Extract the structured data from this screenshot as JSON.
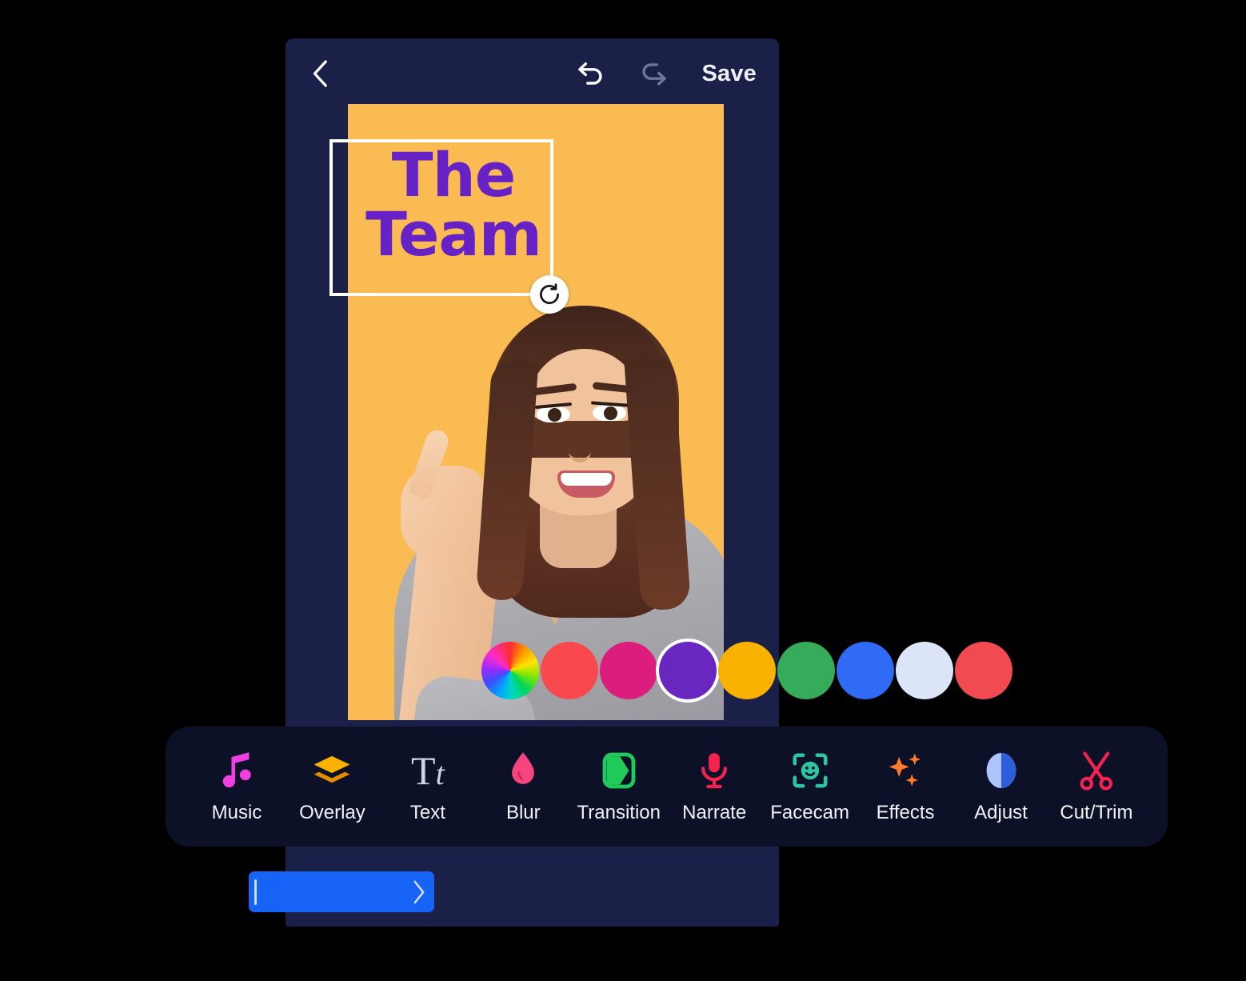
{
  "app": {
    "background_color": "#000000",
    "panel_color": "#1b2049",
    "toolbar_color": "#0d1128"
  },
  "topbar": {
    "back_icon": "chevron-left-icon",
    "undo_icon": "undo-icon",
    "redo_icon": "redo-icon",
    "save_label": "Save",
    "undo_enabled": true,
    "redo_enabled": false
  },
  "canvas": {
    "background_color": "#f9bb52",
    "overlay_text": "The\nTeam",
    "overlay_text_color": "#6622c4",
    "selection_border_color": "#ffffff",
    "rotate_handle_icon": "rotate-icon"
  },
  "swatches": {
    "selected_index": 3,
    "items": [
      {
        "name": "color-wheel",
        "color": "rainbow"
      },
      {
        "name": "coral-red",
        "color": "#f9494f"
      },
      {
        "name": "magenta",
        "color": "#dc1d7e"
      },
      {
        "name": "purple",
        "color": "#6a27c0"
      },
      {
        "name": "amber",
        "color": "#f9b200"
      },
      {
        "name": "green",
        "color": "#36ab5a"
      },
      {
        "name": "blue",
        "color": "#2f6bf5"
      },
      {
        "name": "ice-white",
        "color": "#dce5f7"
      },
      {
        "name": "red",
        "color": "#f14a50"
      }
    ]
  },
  "toolbar": {
    "items": [
      {
        "label": "Music",
        "icon": "music-note-icon",
        "color": "#f13fe0"
      },
      {
        "label": "Overlay",
        "icon": "layers-icon",
        "color": "#f9b200"
      },
      {
        "label": "Text",
        "icon": "text-tt-icon",
        "color": "#cdd3e6"
      },
      {
        "label": "Blur",
        "icon": "droplet-icon",
        "color": "#f5457e"
      },
      {
        "label": "Transition",
        "icon": "transition-icon",
        "color": "#1fc95a"
      },
      {
        "label": "Narrate",
        "icon": "microphone-icon",
        "color": "#f5214f"
      },
      {
        "label": "Facecam",
        "icon": "face-frame-icon",
        "color": "#2ec5a0"
      },
      {
        "label": "Effects",
        "icon": "sparkles-icon",
        "color": "#ff7a29"
      },
      {
        "label": "Adjust",
        "icon": "contrast-icon",
        "color": "#8aa8ff"
      },
      {
        "label": "Cut/Trim",
        "icon": "scissors-icon",
        "color": "#f5214f"
      }
    ]
  },
  "timeline": {
    "clip_color": "#1763f5",
    "playhead_icon": "playhead-icon",
    "handle_icon": "chevron-right-icon"
  }
}
